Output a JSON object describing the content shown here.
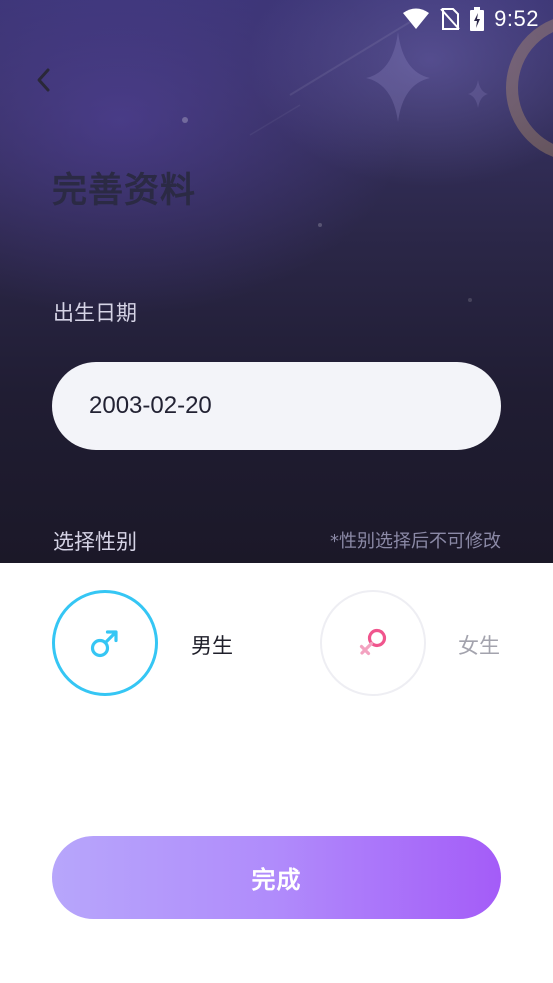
{
  "status_bar": {
    "time": "9:52",
    "icons": [
      "wifi-icon",
      "no-sim-icon",
      "battery-charging-icon"
    ]
  },
  "header": {
    "back_icon": "chevron-left-icon",
    "title": "完善资料"
  },
  "birth_date": {
    "label": "出生日期",
    "value": "2003-02-20"
  },
  "gender": {
    "label": "选择性别",
    "hint": "*性别选择后不可修改",
    "options": [
      {
        "label": "男生",
        "icon": "male-symbol-icon",
        "selected": true,
        "color": "#35c6f4"
      },
      {
        "label": "女生",
        "icon": "female-symbol-icon",
        "selected": false,
        "color": "#f0558d"
      }
    ]
  },
  "actions": {
    "done_label": "完成"
  },
  "colors": {
    "accent_start": "#b7a6fb",
    "accent_end": "#a45cf8",
    "selected_ring": "#35c6f4",
    "hero_dark": "#1b1828"
  }
}
